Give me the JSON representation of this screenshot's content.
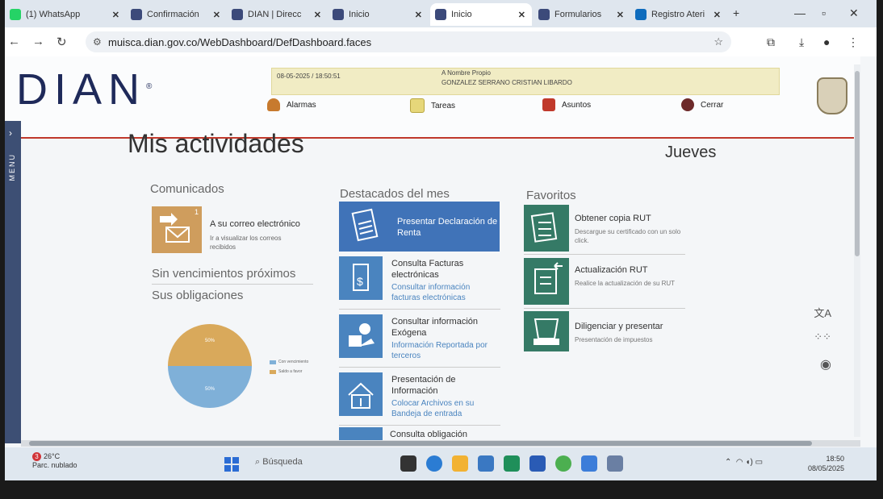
{
  "browser": {
    "tabs": [
      {
        "label": "(1) WhatsApp",
        "icon": "whatsapp-icon",
        "color": "#25d366"
      },
      {
        "label": "Confirmación",
        "icon": "dian-icon",
        "color": "#3c4a7a"
      },
      {
        "label": "DIAN | Direcc",
        "icon": "dian-icon",
        "color": "#3c4a7a"
      },
      {
        "label": "Inicio",
        "icon": "dian-icon",
        "color": "#3c4a7a"
      },
      {
        "label": "Inicio",
        "icon": "dian-icon",
        "color": "#3c4a7a",
        "active": true
      },
      {
        "label": "Formularios",
        "icon": "dian-icon",
        "color": "#3c4a7a"
      },
      {
        "label": "Registro Ateri",
        "icon": "outlook-icon",
        "color": "#0f6cbd"
      }
    ],
    "url": "muisca.dian.gov.co/WebDashboard/DefDashboard.faces"
  },
  "header": {
    "logo_text": "DIAN",
    "datetime": "08-05-2025 / 18:50:51",
    "user_caption": "A Nombre Propio",
    "user_name": "GONZALEZ SERRANO CRISTIAN LIBARDO",
    "menu": [
      {
        "label": "Alarmas",
        "icon": "alarm-icon"
      },
      {
        "label": "Tareas",
        "icon": "tasks-icon"
      },
      {
        "label": "Asuntos",
        "icon": "folder-icon"
      },
      {
        "label": "Cerrar",
        "icon": "power-icon"
      }
    ]
  },
  "sidemenu": {
    "label": "MENU"
  },
  "main": {
    "title": "Mis actividades",
    "day": "Jueves",
    "comunicados": {
      "heading": "Comunicados",
      "badge": "1",
      "mail_title": "A su correo electrónico",
      "mail_sub": "Ir a visualizar los correos recibidos"
    },
    "sin_vencimientos": "Sin vencimientos próximos",
    "sus_obligaciones": "Sus obligaciones",
    "destacados": {
      "heading": "Destacados del mes",
      "items": [
        {
          "title": "Presentar Declaración de Renta",
          "sub": ""
        },
        {
          "title": "Consulta Facturas electrónicas",
          "sub": "Consultar información facturas electrónicas"
        },
        {
          "title": "Consultar información Exógena",
          "sub": "Información Reportada por terceros"
        },
        {
          "title": "Presentación de Información",
          "sub": "Colocar Archivos en su Bandeja de entrada"
        },
        {
          "title": "Consulta obligación",
          "sub": ""
        }
      ]
    },
    "favoritos": {
      "heading": "Favoritos",
      "items": [
        {
          "title": "Obtener copia RUT",
          "sub": "Descargue su certificado con un solo click."
        },
        {
          "title": "Actualización RUT",
          "sub": "Realice la actualización de su RUT"
        },
        {
          "title": "Diligenciar y presentar",
          "sub": "Presentación de impuestos"
        }
      ]
    }
  },
  "chart_data": {
    "type": "pie",
    "labels": [
      "Con vencimiento",
      "Saldo a favor"
    ],
    "values": [
      50,
      50
    ],
    "slice_labels": [
      "50%",
      "50%"
    ],
    "colors": [
      "#7fb0d8",
      "#d9a95b"
    ]
  },
  "taskbar": {
    "temperature": "26°C",
    "weather": "Parc. nublado",
    "weather_badge": "3",
    "search_placeholder": "Búsqueda",
    "time": "18:50",
    "date": "08/05/2025"
  }
}
